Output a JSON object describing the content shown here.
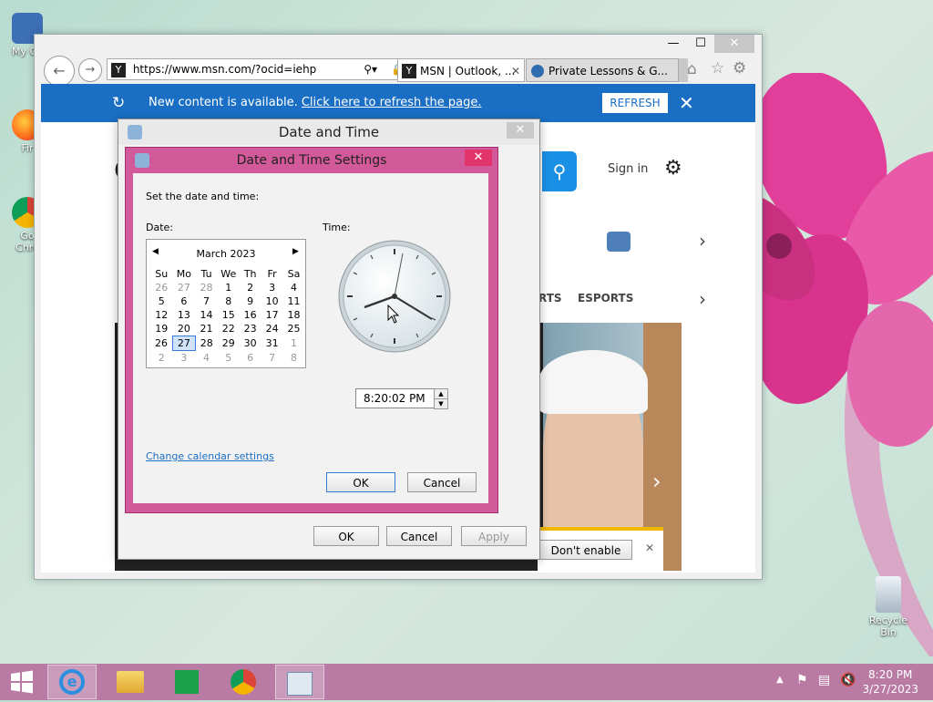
{
  "desktop": {
    "icons": [
      {
        "label": "My Co"
      },
      {
        "label": "Fir"
      },
      {
        "label": "Go\nChro"
      },
      {
        "label": "Recycle Bin"
      }
    ]
  },
  "ie": {
    "address": "https://www.msn.com/?ocid=iehp",
    "tabs": [
      {
        "label": "MSN | Outlook, ..."
      },
      {
        "label": "Private Lessons & G..."
      }
    ],
    "notification": {
      "text": "New content is available.",
      "link": "Click here to refresh the page.",
      "button": "REFRESH"
    },
    "msn": {
      "sign_in": "Sign in",
      "nav_sports": "RTS",
      "nav_esports": "ESPORTS",
      "letter": "g",
      "partial_e": "e",
      "banner_button": "Don't enable"
    }
  },
  "date_time_dialog": {
    "title": "Date and Time",
    "ok": "OK",
    "cancel": "Cancel",
    "apply": "Apply"
  },
  "settings_dialog": {
    "title": "Date and Time Settings",
    "instruction": "Set the date and time:",
    "date_label": "Date:",
    "time_label": "Time:",
    "month": "March 2023",
    "weekdays": [
      "Su",
      "Mo",
      "Tu",
      "We",
      "Th",
      "Fr",
      "Sa"
    ],
    "weeks": [
      [
        "26",
        "27",
        "28",
        "1",
        "2",
        "3",
        "4"
      ],
      [
        "5",
        "6",
        "7",
        "8",
        "9",
        "10",
        "11"
      ],
      [
        "12",
        "13",
        "14",
        "15",
        "16",
        "17",
        "18"
      ],
      [
        "19",
        "20",
        "21",
        "22",
        "23",
        "24",
        "25"
      ],
      [
        "26",
        "27",
        "28",
        "29",
        "30",
        "31",
        "1"
      ],
      [
        "2",
        "3",
        "4",
        "5",
        "6",
        "7",
        "8"
      ]
    ],
    "selected_day": "27",
    "time_value": "8:20:02 PM",
    "change_calendar": "Change calendar settings",
    "ok": "OK",
    "cancel": "Cancel"
  },
  "taskbar": {
    "time": "8:20 PM",
    "date": "3/27/2023"
  },
  "colors": {
    "accent": "#1a6fc4",
    "dialog_frame": "#d25a9a",
    "taskbar": "#b97ba4"
  }
}
